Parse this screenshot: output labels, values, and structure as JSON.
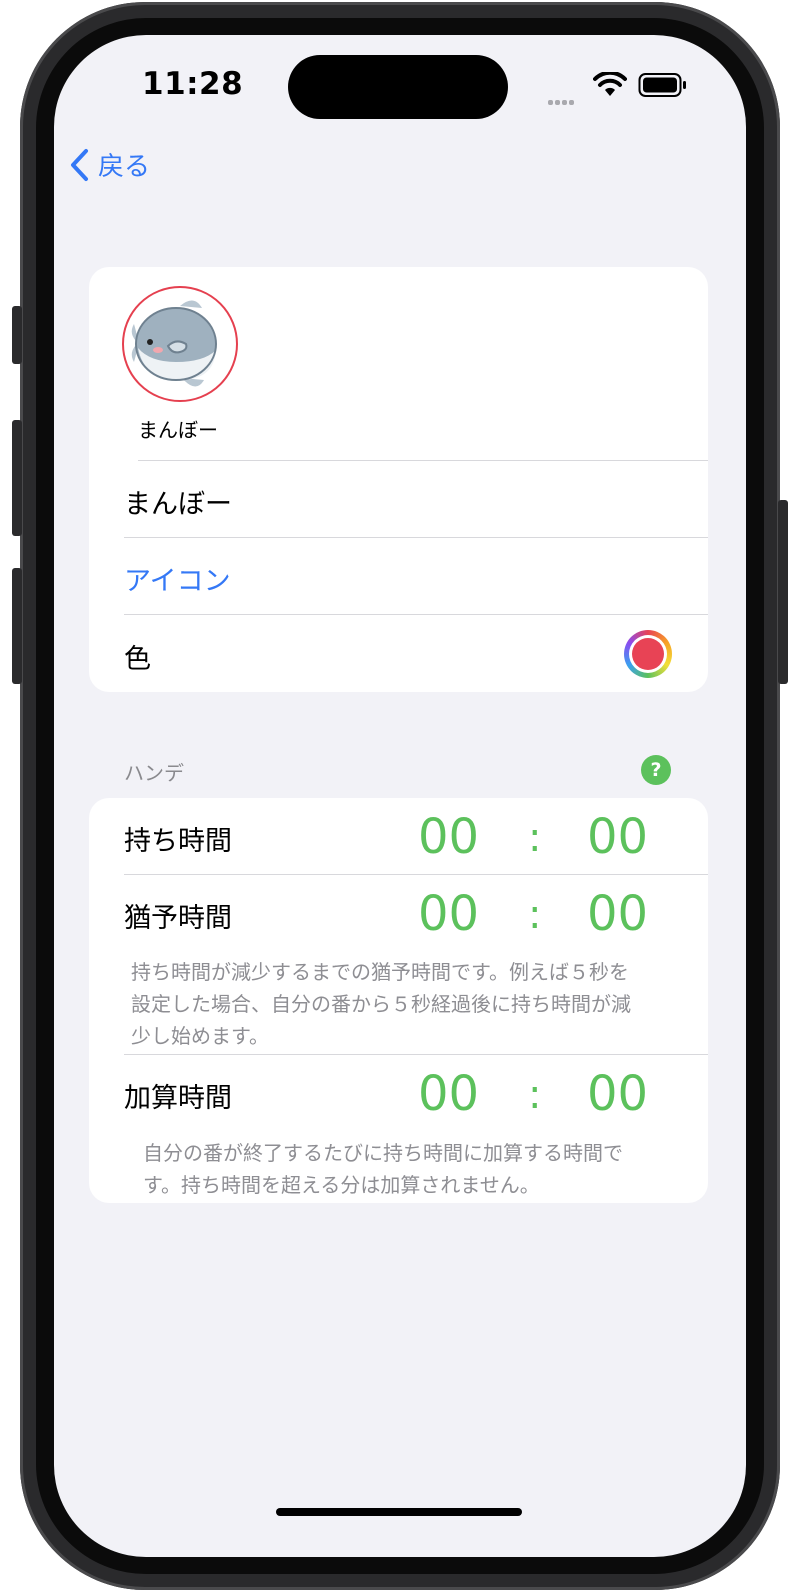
{
  "status_bar": {
    "time": "11:28"
  },
  "nav": {
    "back_label": "戻る"
  },
  "profile": {
    "caption": "まんぼー",
    "name_value": "まんぼー",
    "icon_label": "アイコン",
    "color_label": "色",
    "color_value": "#e84355"
  },
  "handicap": {
    "header": "ハンデ",
    "help_symbol": "?",
    "rows": [
      {
        "label": "持ち時間",
        "minutes": "00",
        "seconds": "00"
      },
      {
        "label": "猶予時間",
        "minutes": "00",
        "seconds": "00"
      },
      {
        "label": "加算時間",
        "minutes": "00",
        "seconds": "00"
      }
    ],
    "grace_footer_lines": [
      "持ち時間が減少するまでの猶予時間です。例えば５秒を",
      "設定した場合、自分の番から５秒経過後に持ち時間が減",
      "少し始めます。"
    ],
    "add_footer_lines": [
      "自分の番が終了するたびに持ち時間に加算する時間で",
      "す。持ち時間を超える分は加算されません。"
    ],
    "separator": ":"
  },
  "colors": {
    "accent": "#3478f6",
    "timer_green": "#5cc15c",
    "help_green": "#5cc15c",
    "avatar_ring": "#e5404f"
  }
}
